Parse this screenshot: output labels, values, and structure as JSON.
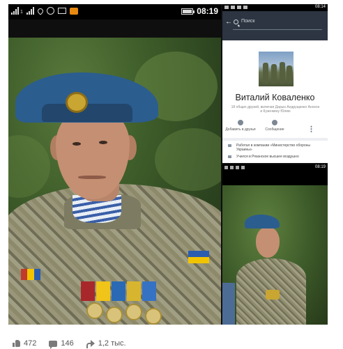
{
  "left_panel": {
    "status_time": "08:19",
    "signal_label": "1",
    "icons": [
      "signal-icon",
      "signal-icon",
      "location-icon",
      "viber-icon",
      "image-icon",
      "ok-icon",
      "battery-icon"
    ]
  },
  "profile_screen": {
    "status_time": "08:14",
    "back_icon": "back-arrow-icon",
    "search_placeholder": "Поиск",
    "name": "Виталий Коваленко",
    "mutual_friends": "18 общих друзей, включая Дарью Андрущенко Анохон и Кузенкину Юлию",
    "actions": [
      {
        "label": "Добавить в друзья",
        "icon": "add-friend-icon"
      },
      {
        "label": "Сообщение",
        "icon": "message-icon"
      }
    ],
    "more_icon": "more-icon",
    "info": [
      "Работал в компании «Министерство обороны Украины»",
      "Учился в Рязанское высшее воздушно"
    ]
  },
  "small_photo": {
    "status_time": "08:19"
  },
  "footer": {
    "likes": "472",
    "comments": "146",
    "shares": "1,2 тыс."
  },
  "colors": {
    "fb_header": "#2c3541",
    "beret_blue": "#2b5d8f",
    "flag_blue": "#2a5db0",
    "flag_yellow": "#f2c400",
    "footer_text": "#555555"
  }
}
